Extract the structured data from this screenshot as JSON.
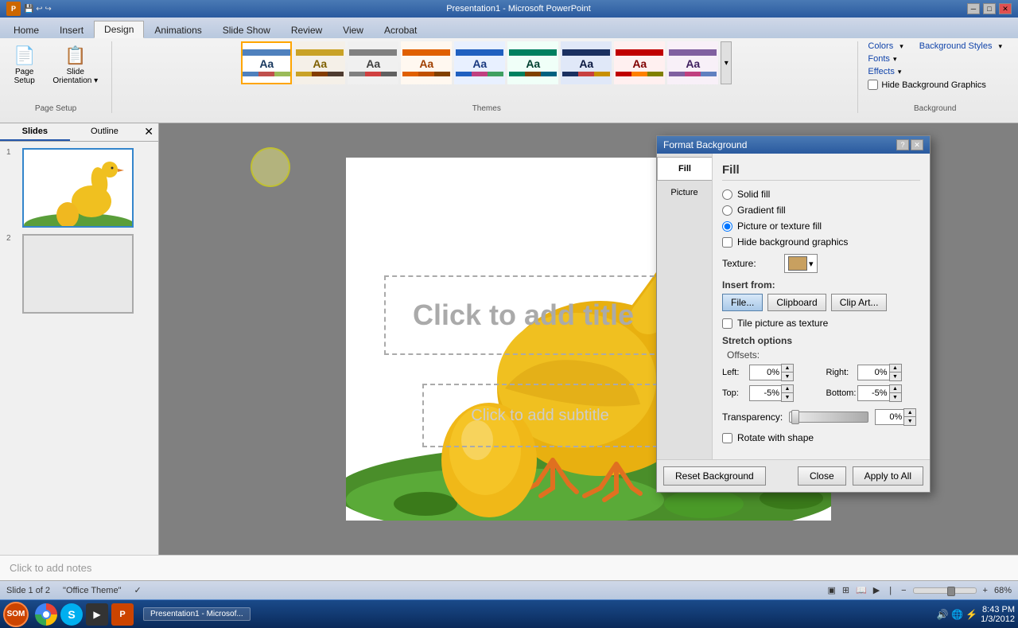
{
  "titlebar": {
    "title": "Presentation1 - Microsoft PowerPoint",
    "minimize": "─",
    "maximize": "□",
    "close": "✕"
  },
  "ribbon": {
    "tabs": [
      "Home",
      "Insert",
      "Design",
      "Animations",
      "Slide Show",
      "Review",
      "View",
      "Acrobat"
    ],
    "active_tab": "Design",
    "groups": {
      "page_setup": {
        "label": "Page Setup",
        "buttons": [
          "Page\nSetup",
          "Slide\nOrientation"
        ]
      },
      "themes": {
        "label": "Themes"
      },
      "background": {
        "label": "Background",
        "colors": "Colors",
        "fonts": "Fonts",
        "effects": "Effects",
        "background_styles": "Background Styles",
        "hide_bg": "Hide Background Graphics"
      }
    }
  },
  "slide_panel": {
    "tabs": [
      "Slides",
      "Outline"
    ],
    "active_tab": "Slides",
    "slides": [
      {
        "num": "1",
        "selected": true
      },
      {
        "num": "2",
        "selected": false
      }
    ]
  },
  "canvas": {
    "title_placeholder": "Click to add title",
    "subtitle_placeholder": "Click to add subtitle"
  },
  "dialog": {
    "title": "Format Background",
    "sidebar": [
      "Fill",
      "Picture"
    ],
    "active_sidebar": "Fill",
    "section_title": "Fill",
    "fill_options": [
      "Solid fill",
      "Gradient fill",
      "Picture or texture fill"
    ],
    "active_fill": "Picture or texture fill",
    "hide_background": "Hide background graphics",
    "texture_label": "Texture:",
    "insert_from": "Insert from:",
    "file_btn": "File...",
    "clipboard_btn": "Clipboard",
    "clip_art_btn": "Clip Art...",
    "tile_checkbox": "Tile picture as texture",
    "stretch_options": "Stretch options",
    "offsets_label": "Offsets:",
    "left_label": "Left:",
    "left_val": "0%",
    "right_label": "Right:",
    "right_val": "0%",
    "top_label": "Top:",
    "top_val": "-5%",
    "bottom_label": "Bottom:",
    "bottom_val": "-5%",
    "transparency_label": "Transparency:",
    "transparency_val": "0%",
    "rotate_checkbox": "Rotate with shape",
    "reset_btn": "Reset Background",
    "close_btn": "Close",
    "apply_all_btn": "Apply to All"
  },
  "statusbar": {
    "slide_info": "Slide 1 of 2",
    "theme": "\"Office Theme\"",
    "zoom": "68%",
    "view_normal": "Normal",
    "time": "8:43 PM",
    "date": "1/3/2012"
  },
  "notes": {
    "placeholder": "Click to add notes"
  },
  "taskbar": {
    "logo_text": "SOM",
    "app_label": "Presentation1 - Microsof...",
    "time": "8:43 PM",
    "date": "1/3/2012"
  }
}
